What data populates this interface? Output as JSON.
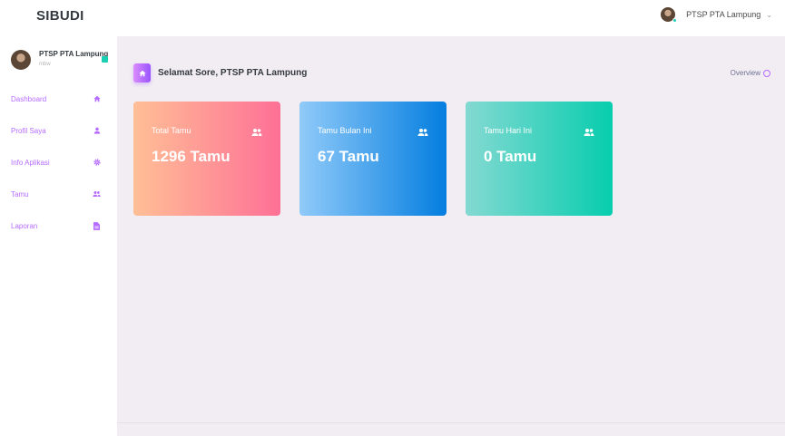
{
  "app": {
    "brand": "SIBUDI"
  },
  "topbar": {
    "user_name": "PTSP PTA Lampung",
    "chevron": "⌄"
  },
  "sidebar": {
    "profile": {
      "name": "PTSP PTA Lampung",
      "role": "mbw"
    },
    "items": [
      {
        "label": "Dashboard",
        "icon": "home-icon"
      },
      {
        "label": "Profil Saya",
        "icon": "user-icon"
      },
      {
        "label": "Info Aplikasi",
        "icon": "gear-icon"
      },
      {
        "label": "Tamu",
        "icon": "users-icon"
      },
      {
        "label": "Laporan",
        "icon": "document-icon"
      }
    ]
  },
  "header": {
    "title": "Selamat Sore, PTSP PTA Lampung",
    "overview": "Overview"
  },
  "cards": [
    {
      "title": "Total Tamu",
      "value": "1296 Tamu",
      "icon": "users-icon",
      "gradient": [
        "#ffbf96",
        "#fe7096"
      ]
    },
    {
      "title": "Tamu Bulan Ini",
      "value": "67 Tamu",
      "icon": "users-icon",
      "gradient": [
        "#90caf9",
        "#047edf"
      ]
    },
    {
      "title": "Tamu Hari Ini",
      "value": "0 Tamu",
      "icon": "users-icon",
      "gradient": [
        "#84d9d2",
        "#07cdae"
      ]
    }
  ],
  "colors": {
    "accent": "#b66dff",
    "background": "#f2edf3",
    "success": "#1bcfb4"
  }
}
